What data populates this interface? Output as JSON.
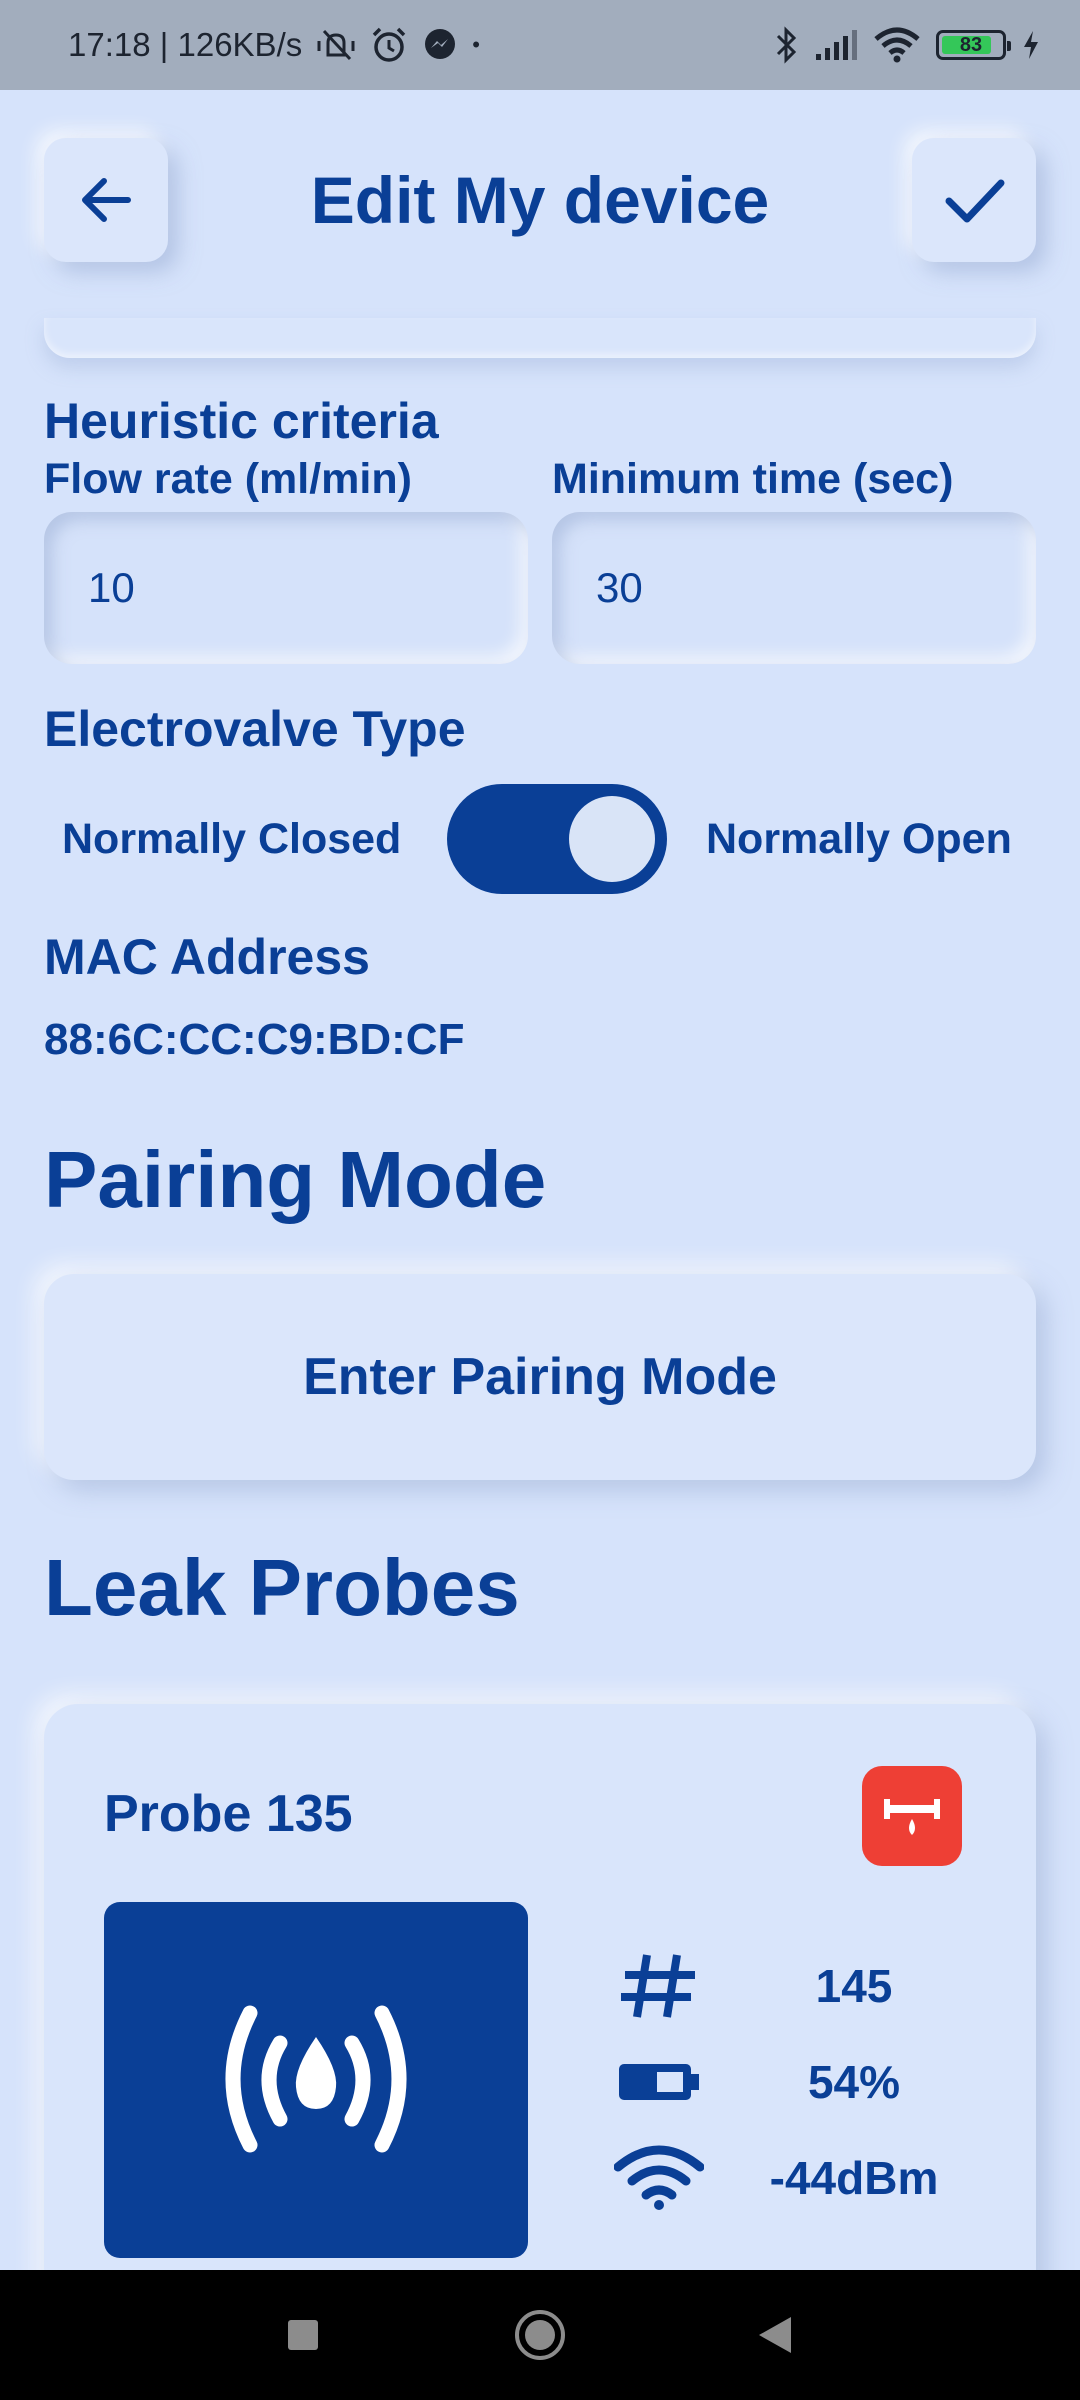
{
  "status_bar": {
    "time_speed": "17:18 | 126KB/s",
    "dot": "•",
    "battery_level": "83"
  },
  "header": {
    "title": "Edit My device",
    "back_icon": "arrow-left-icon",
    "confirm_icon": "check-icon"
  },
  "heuristic": {
    "title": "Heuristic criteria",
    "flow_rate_label": "Flow rate (ml/min)",
    "flow_rate_value": "10",
    "min_time_label": "Minimum time (sec)",
    "min_time_value": "30"
  },
  "electrovalve": {
    "title": "Electrovalve Type",
    "left_label": "Normally Closed",
    "right_label": "Normally Open",
    "toggle_on": true
  },
  "mac": {
    "title": "MAC Address",
    "value": "88:6C:CC:C9:BD:CF"
  },
  "pairing": {
    "title": "Pairing Mode",
    "button_label": "Enter Pairing Mode"
  },
  "probes": {
    "title": "Leak Probes",
    "items": [
      {
        "name": "Probe 135",
        "id_value": "145",
        "battery": "54%",
        "signal": "-44dBm",
        "alert_color": "#ee3f35"
      }
    ]
  },
  "colors": {
    "primary": "#0a3f96",
    "background": "#d6e3fb",
    "alert": "#ee3f35"
  }
}
